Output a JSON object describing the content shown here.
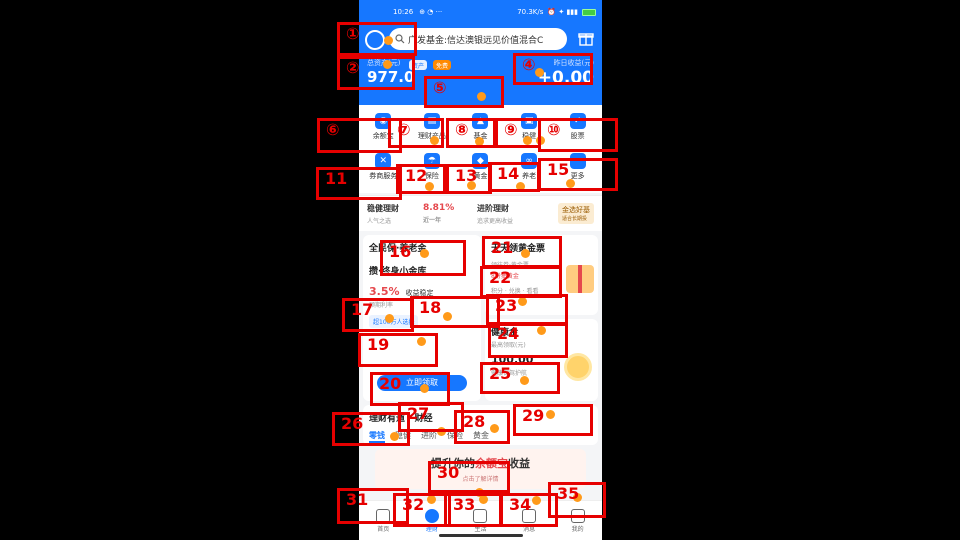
{
  "status_bar": {
    "time": "10:26",
    "indicators": "⊕ ◔ ···",
    "net_speed": "70.3K/s",
    "icons": "⏰ ✦ ▮▮▮"
  },
  "header": {
    "search_placeholder": "广发基金:信达澳银远见价值混合C",
    "total_assets_label": "总资产(元)",
    "total_assets_value": "977.0",
    "pill1": "资产",
    "pill2": "免费",
    "yesterday_label": "昨日收益(元)",
    "yesterday_value": "+0.00"
  },
  "grid": {
    "row1": [
      {
        "label": "余额宝",
        "icon": "coin-icon",
        "glyph": "◉"
      },
      {
        "label": "理财产品",
        "icon": "bag-icon",
        "glyph": "▤"
      },
      {
        "label": "基金",
        "icon": "chart-icon",
        "glyph": "▲"
      },
      {
        "label": "稳健",
        "icon": "lock-icon",
        "glyph": "▣"
      },
      {
        "label": "股票",
        "icon": "check-icon",
        "glyph": "✓"
      }
    ],
    "row2": [
      {
        "label": "券商服务",
        "icon": "ticket-icon",
        "glyph": "✕"
      },
      {
        "label": "保险",
        "icon": "umbrella-icon",
        "glyph": "☂"
      },
      {
        "label": "黄金",
        "icon": "gold-icon",
        "glyph": "◆"
      },
      {
        "label": "养老",
        "icon": "infinity-icon",
        "glyph": "∞"
      },
      {
        "label": "更多",
        "icon": "more-icon",
        "glyph": "⋯"
      }
    ]
  },
  "strip": {
    "a_title": "稳健理财",
    "a_sub": "人气之选",
    "pct": "8.81%",
    "pct_sub": "近一年",
    "b_title": "进阶理财",
    "b_sub": "追求更高收益",
    "tag": "金选好基",
    "tag_sub": "适合长期投"
  },
  "cardA": {
    "title": "全民保·养老金",
    "subtitle": "攒·终身小金库",
    "rate": "3.5%",
    "rate_note": "收益稳定",
    "rate_sub": "预期利率",
    "link": "超100万人选择",
    "cta": "立即领取"
  },
  "cardB": {
    "title": "天天领黄金票",
    "line1": "领往券·黄金票",
    "line2": "8份抽黄金",
    "line3": "积分 · 兑换 · 看看"
  },
  "cardC": {
    "title": "健康金",
    "line1": "最高领取(元)",
    "amount": "100.00",
    "line2": "健康保驾护航"
  },
  "wealth": {
    "title": "理财有道 · 财经",
    "tabs": [
      "零钱",
      "稳健",
      "进阶",
      "保险",
      "黄金"
    ]
  },
  "promo": {
    "pre": "提升你的",
    "highlight": "余额宝",
    "post": "收益",
    "sub": "点击了解详情"
  },
  "bottom_nav": [
    {
      "label": "首页",
      "icon": "home-icon"
    },
    {
      "label": "理财",
      "icon": "wealth-icon"
    },
    {
      "label": "生活",
      "icon": "life-icon"
    },
    {
      "label": "消息",
      "icon": "chat-icon"
    },
    {
      "label": "我的",
      "icon": "profile-icon"
    }
  ],
  "annotations": [
    "①",
    "②",
    "④",
    "⑤",
    "⑥",
    "⑦",
    "⑧",
    "⑨",
    "⑩",
    "11",
    "12",
    "13",
    "14",
    "15",
    "16",
    "17",
    "18",
    "19",
    "20",
    "21",
    "22",
    "23",
    "24",
    "25",
    "26",
    "27",
    "28",
    "29",
    "30",
    "31",
    "32",
    "33",
    "34",
    "35"
  ],
  "colors": {
    "brand": "#1677ff",
    "accent": "#e5484d",
    "marker": "#e60000",
    "dot": "#ff9a1a"
  }
}
